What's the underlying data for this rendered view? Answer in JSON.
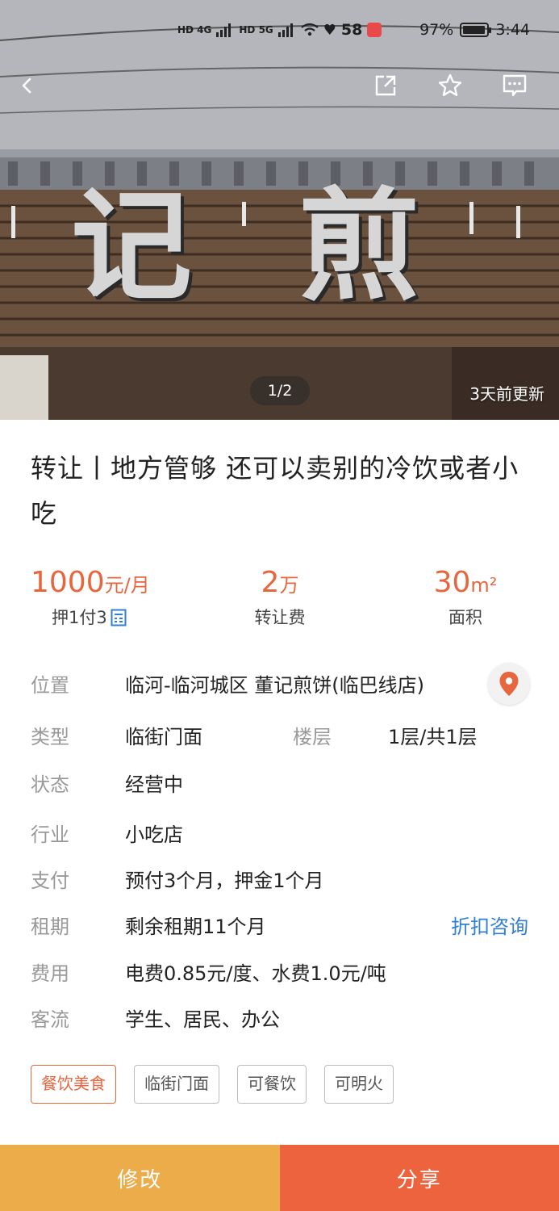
{
  "status_bar": {
    "network_left": "HD 4G",
    "network_right": "HD 5G",
    "notification_count": "58",
    "battery_percent": "97%",
    "battery_level": 0.97,
    "time": "3:44"
  },
  "hero": {
    "sign_chars": [
      "记",
      "煎"
    ],
    "image_counter": "1/2",
    "updated_text": "3天前更新"
  },
  "listing": {
    "title": "转让丨地方管够 还可以卖别的冷饮或者小吃"
  },
  "stats": {
    "rent_value": "1000",
    "rent_unit": "元/月",
    "rent_label": "押1付3",
    "transfer_value": "2",
    "transfer_unit": "万",
    "transfer_label": "转让费",
    "area_value": "30",
    "area_unit": "m²",
    "area_label": "面积"
  },
  "details": {
    "location_key": "位置",
    "location_value": "临河-临河城区 董记煎饼(临巴线店)",
    "type_key": "类型",
    "type_value": "临街门面",
    "floor_key": "楼层",
    "floor_value": "1层/共1层",
    "status_key": "状态",
    "status_value": "经营中",
    "industry_key": "行业",
    "industry_value": "小吃店",
    "payment_key": "支付",
    "payment_value": "预付3个月，押金1个月",
    "lease_key": "租期",
    "lease_value": "剩余租期11个月",
    "lease_link": "折扣咨询",
    "fees_key": "费用",
    "fees_value": "电费0.85元/度、水费1.0元/吨",
    "traffic_key": "客流",
    "traffic_value": "学生、居民、办公"
  },
  "tags": [
    "餐饮美食",
    "临街门面",
    "可餐饮",
    "可明火"
  ],
  "bottom": {
    "edit_label": "修改",
    "share_label": "分享"
  },
  "colors": {
    "accent": "#e8663d",
    "link": "#2f7fd6",
    "edit_button": "#ecac4a",
    "share_button": "#ec633e"
  },
  "icons": {
    "back": "back-arrow-icon",
    "share": "share-icon",
    "favorite": "star-icon",
    "message": "message-icon",
    "map": "map-pin-icon",
    "calculator": "calculator-icon"
  }
}
